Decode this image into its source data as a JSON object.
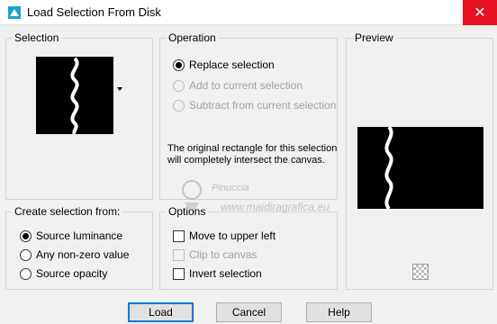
{
  "window": {
    "title": "Load Selection From Disk",
    "close_glyph": "✕",
    "accent": "#e81123"
  },
  "selection": {
    "title": "Selection"
  },
  "operation": {
    "title": "Operation",
    "options": [
      {
        "label": "Replace selection",
        "checked": true,
        "disabled": false
      },
      {
        "label": "Add to current selection",
        "checked": false,
        "disabled": true
      },
      {
        "label": "Subtract from current selection",
        "checked": false,
        "disabled": true
      }
    ],
    "info": "The original rectangle for this selection will completely intersect the canvas."
  },
  "preview": {
    "title": "Preview"
  },
  "create_from": {
    "title": "Create selection from:",
    "options": [
      {
        "label": "Source luminance",
        "checked": true
      },
      {
        "label": "Any non-zero value",
        "checked": false
      },
      {
        "label": "Source opacity",
        "checked": false
      }
    ]
  },
  "options": {
    "title": "Options",
    "items": [
      {
        "label": "Move to upper left",
        "checked": false,
        "disabled": false
      },
      {
        "label": "Clip to canvas",
        "checked": false,
        "disabled": true
      },
      {
        "label": "Invert selection",
        "checked": false,
        "disabled": false
      }
    ]
  },
  "buttons": {
    "load": "Load",
    "cancel": "Cancel",
    "help": "Help"
  },
  "watermark": {
    "name": "Pinuccia",
    "url": "www.maidiragrafica.eu"
  }
}
